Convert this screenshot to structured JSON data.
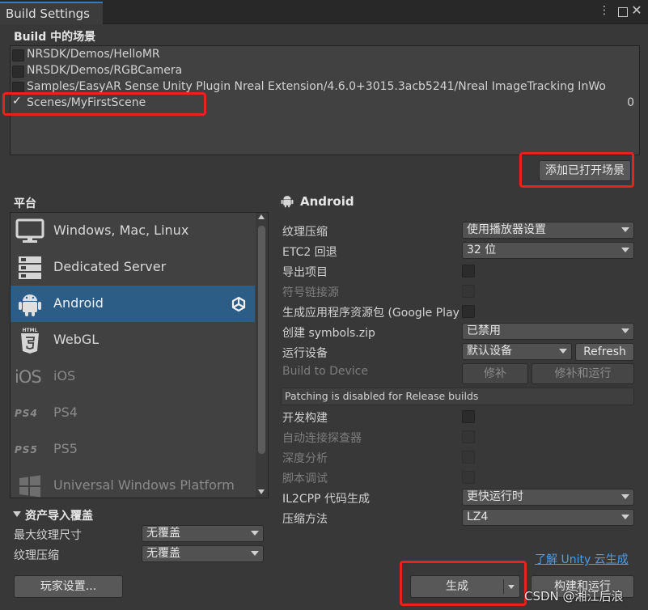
{
  "window": {
    "tab_title": "Build Settings"
  },
  "scenes": {
    "title": "Build 中的场景",
    "items": [
      {
        "name": "NRSDK/Demos/HelloMR",
        "checked": false,
        "index": ""
      },
      {
        "name": "NRSDK/Demos/RGBCamera",
        "checked": false,
        "index": ""
      },
      {
        "name": "Samples/EasyAR Sense Unity Plugin Nreal Extension/4.6.0+3015.3acb5241/Nreal ImageTracking InWo",
        "checked": false,
        "index": ""
      },
      {
        "name": "Scenes/MyFirstScene",
        "checked": true,
        "index": "0"
      }
    ],
    "add_open_scenes_label": "添加已打开场景"
  },
  "platform": {
    "title": "平台",
    "items": [
      {
        "label": "Windows, Mac, Linux",
        "icon": "monitor-icon",
        "selected": false,
        "dim": false
      },
      {
        "label": "Dedicated Server",
        "icon": "server-icon",
        "selected": false,
        "dim": false
      },
      {
        "label": "Android",
        "icon": "android-icon",
        "selected": true,
        "dim": false
      },
      {
        "label": "WebGL",
        "icon": "html5-icon",
        "selected": false,
        "dim": false
      },
      {
        "label": "iOS",
        "icon": "ios-icon",
        "icon_text": "iOS",
        "selected": false,
        "dim": false
      },
      {
        "label": "PS4",
        "icon": "ps4-icon",
        "icon_text": "PS4",
        "selected": false,
        "dim": false
      },
      {
        "label": "PS5",
        "icon": "ps5-icon",
        "icon_text": "PS5",
        "selected": false,
        "dim": false
      },
      {
        "label": "Universal Windows Platform",
        "icon": "windows-icon",
        "selected": false,
        "dim": true
      }
    ]
  },
  "android": {
    "title": "Android",
    "texture_compression": {
      "label": "纹理压缩",
      "value": "使用播放器设置"
    },
    "etc2_fallback": {
      "label": "ETC2 回退",
      "value": "32 位"
    },
    "export_project": {
      "label": "导出项目",
      "checked": false
    },
    "symlink_sources": {
      "label": "符号链接源",
      "checked": false
    },
    "build_app_bundle": {
      "label": "生成应用程序资源包 (Google Play)",
      "checked": false
    },
    "create_symbols": {
      "label": "创建 symbols.zip",
      "value": "已禁用"
    },
    "run_device": {
      "label": "运行设备",
      "value": "默认设备",
      "refresh_label": "Refresh"
    },
    "build_to_device": {
      "label": "Build to Device",
      "patch_label": "修补",
      "patch_run_label": "修补和运行"
    },
    "patching_note": "Patching is disabled for Release builds",
    "development_build": {
      "label": "开发构建",
      "checked": false
    },
    "autoconnect_profiler": {
      "label": "自动连接探查器",
      "checked": false
    },
    "deep_profiling": {
      "label": "深度分析",
      "checked": false
    },
    "script_debugging": {
      "label": "脚本调试",
      "checked": false
    },
    "il2cpp_codegen": {
      "label": "IL2CPP 代码生成",
      "value": "更快运行时"
    },
    "compression_method": {
      "label": "压缩方法",
      "value": "LZ4"
    }
  },
  "asset_import_overrides": {
    "title": "资产导入覆盖",
    "max_texture_size": {
      "label": "最大纹理尺寸",
      "value": "无覆盖"
    },
    "texture_compression": {
      "label": "纹理压缩",
      "value": "无覆盖"
    }
  },
  "footer": {
    "cloud_build_link": "了解 Unity 云生成",
    "player_settings_label": "玩家设置...",
    "build_label": "生成",
    "build_and_run_label": "构建和运行"
  },
  "watermark": "CSDN @湘江后浪",
  "colors": {
    "accent_selection": "#2c5d87",
    "highlight_red": "#e8231d",
    "link": "#4c9dea"
  }
}
